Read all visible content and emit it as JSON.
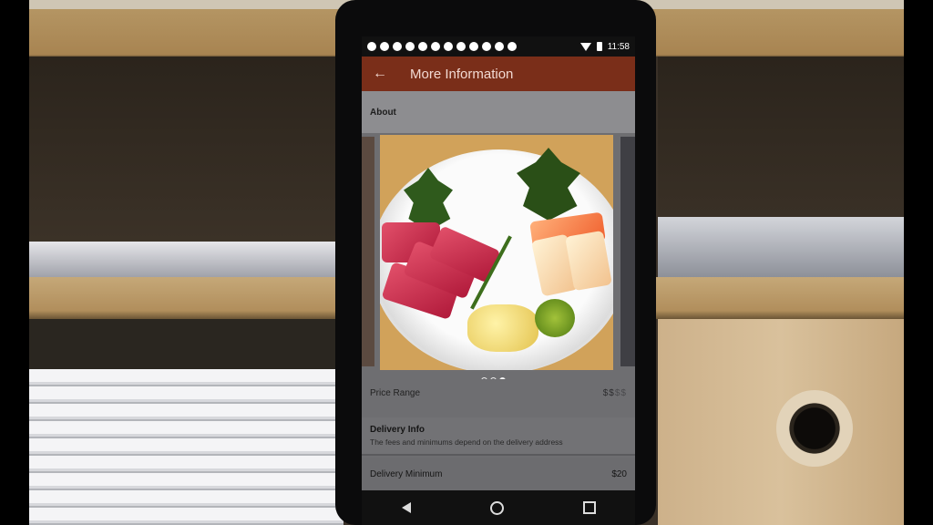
{
  "status_bar": {
    "time": "11:58"
  },
  "app_bar": {
    "back_icon": "arrow-left-icon",
    "title": "More Information"
  },
  "about": {
    "label": "About"
  },
  "carousel": {
    "page_count": 3,
    "active_index": 2,
    "image_subject": "sashimi-plate"
  },
  "price_range": {
    "label": "Price Range",
    "active": "$$",
    "inactive": "$$"
  },
  "delivery_info": {
    "title": "Delivery Info",
    "subtitle": "The fees and minimums depend on the delivery address"
  },
  "delivery_minimum": {
    "label": "Delivery Minimum",
    "value": "$20"
  },
  "colors": {
    "app_bar": "#7a2e19",
    "status_bar": "#111111"
  },
  "nav_bar": {
    "icons": [
      "back-triangle-icon",
      "home-circle-icon",
      "recents-square-icon"
    ]
  }
}
